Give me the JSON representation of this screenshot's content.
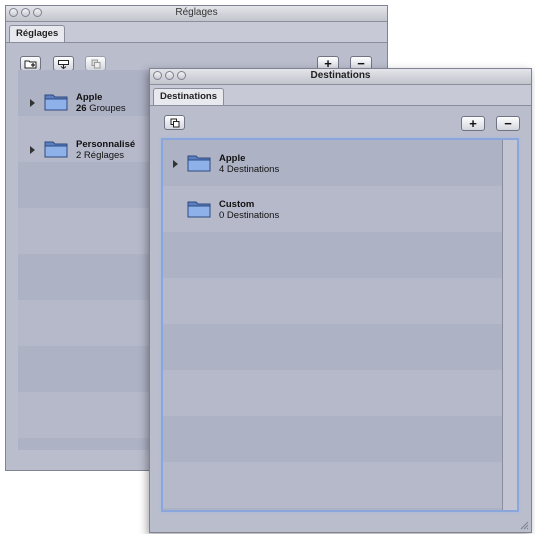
{
  "back_window": {
    "title": "Réglages",
    "tab": "Réglages",
    "toolbar": {
      "new_folder_icon": "new-folder-icon",
      "upload_icon": "upload-icon",
      "duplicate_icon": "duplicate-icon",
      "add_label": "+",
      "remove_label": "−"
    },
    "items": [
      {
        "name": "Apple",
        "detail_count": "26",
        "detail_word": "Groupes",
        "has_disclosure": true
      },
      {
        "name": "Personnalisé",
        "detail": "2 Réglages",
        "has_disclosure": true
      }
    ]
  },
  "front_window": {
    "title": "Destinations",
    "tab": "Destinations",
    "toolbar": {
      "duplicate_icon": "duplicate-icon",
      "add_label": "+",
      "remove_label": "−"
    },
    "items": [
      {
        "name": "Apple",
        "detail": "4 Destinations",
        "has_disclosure": true
      },
      {
        "name": "Custom",
        "detail": "0 Destinations",
        "has_disclosure": false
      }
    ]
  },
  "colors": {
    "window_bg": "#b9bdcc",
    "list_bg": "#aeb2c5",
    "list_row_alt": "#b6b9ca",
    "focus_ring": "#8aa6dd",
    "folder_blue": "#6f95d6"
  }
}
